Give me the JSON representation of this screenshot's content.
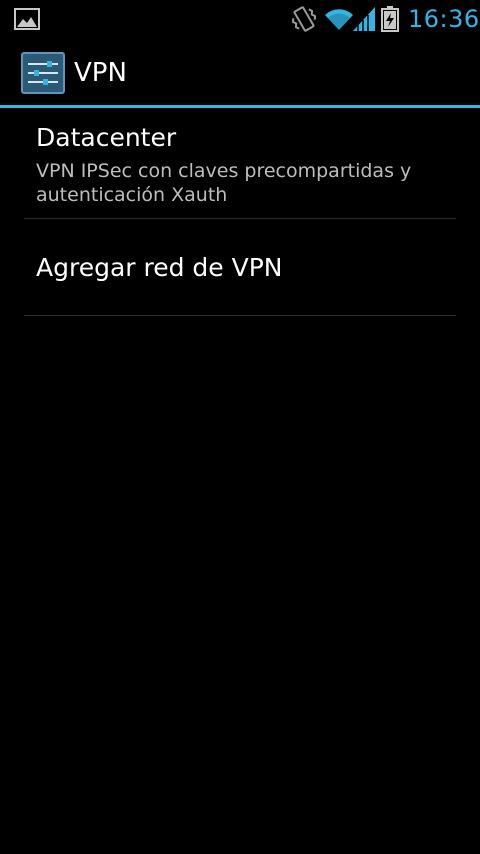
{
  "status_bar": {
    "time": "16:36",
    "accent_color": "#33b5e5",
    "icons": [
      "gallery-notification-icon",
      "vibrate-icon",
      "wifi-icon",
      "signal-icon",
      "battery-charging-icon"
    ]
  },
  "action_bar": {
    "title": "VPN",
    "icon": "settings-sliders-icon",
    "divider_color": "#33b5e5"
  },
  "list": {
    "items": [
      {
        "title": "Datacenter",
        "summary": "VPN IPSec con claves precompartidas y autenticación Xauth"
      },
      {
        "title": "Agregar red de VPN"
      }
    ]
  }
}
